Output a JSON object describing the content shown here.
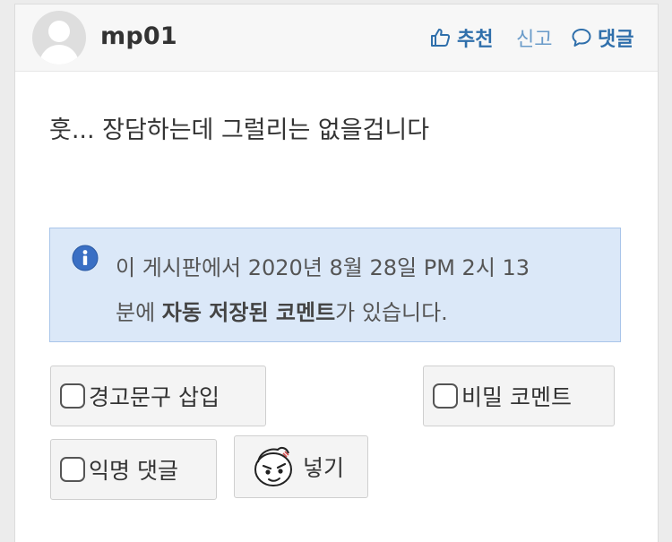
{
  "comment": {
    "username": "mp01",
    "content": "훗... 장담하는데 그럴리는 없을겁니다"
  },
  "actions": {
    "recommend_label": "추천",
    "report_label": "신고",
    "comment_label": "댓글"
  },
  "notice": {
    "line1": "이 게시판에서 2020년 8월 28일 PM 2시 13",
    "line2_prefix": "분에 ",
    "line2_bold": "자동 저장된 코멘트",
    "line2_suffix": "가 있습니다."
  },
  "options": {
    "warning_label": "경고문구 삽입",
    "secret_label": "비밀 코멘트",
    "anonymous_label": "익명 댓글",
    "insert_label": "넣기"
  },
  "colors": {
    "link": "#2f6fab",
    "notice_bg": "#dbe8f8",
    "notice_border": "#a9c5ea",
    "info_icon": "#3a6fc4"
  }
}
